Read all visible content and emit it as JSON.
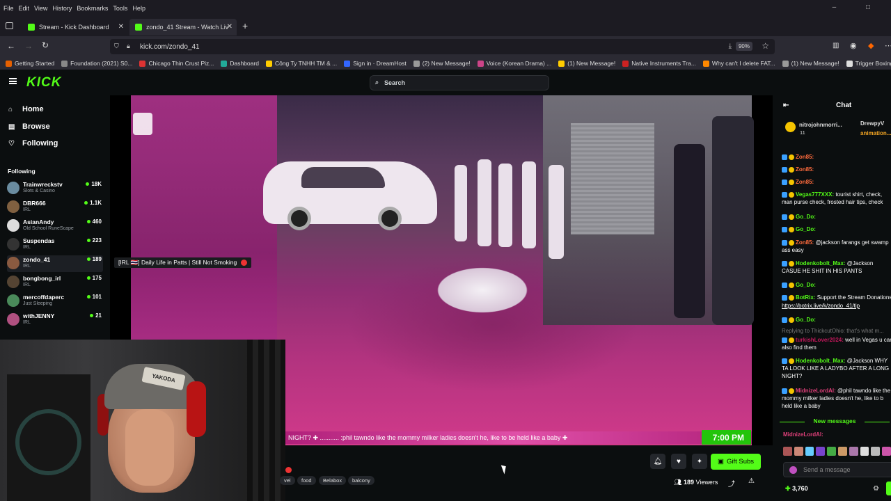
{
  "browser": {
    "menu": [
      "File",
      "Edit",
      "View",
      "History",
      "Bookmarks",
      "Tools",
      "Help"
    ],
    "tabs": [
      {
        "title": "Stream - Kick Dashboard",
        "active": false
      },
      {
        "title": "zondo_41 Stream - Watch Live",
        "active": true
      }
    ],
    "url": "kick.com/zondo_41",
    "zoom": "90%",
    "bookmarks": [
      {
        "label": "Getting Started",
        "color": "#e66000"
      },
      {
        "label": "Foundation (2021) S0...",
        "color": "#888"
      },
      {
        "label": "Chicago Thin Crust Piz...",
        "color": "#d33"
      },
      {
        "label": "Dashboard",
        "color": "#2a9"
      },
      {
        "label": "Công Ty TNHH TM & ...",
        "color": "#fc0"
      },
      {
        "label": "Sign in · DreamHost",
        "color": "#36f"
      },
      {
        "label": "(2) New Message!",
        "color": "#999"
      },
      {
        "label": "Voice (Korean Drama) ...",
        "color": "#c48"
      },
      {
        "label": "(1) New Message!",
        "color": "#fc0"
      },
      {
        "label": "Native Instruments Tra...",
        "color": "#c22"
      },
      {
        "label": "Why can't I delete FAT...",
        "color": "#f80"
      },
      {
        "label": "(1) New Message!",
        "color": "#999"
      },
      {
        "label": "Trigger Boxing",
        "color": "#ddd"
      }
    ]
  },
  "kick": {
    "logo": "KICK",
    "search_placeholder": "Search",
    "accent": "#53fc18",
    "nav": [
      {
        "label": "Home",
        "icon": "home-icon"
      },
      {
        "label": "Browse",
        "icon": "browse-icon"
      },
      {
        "label": "Following",
        "icon": "heart-icon"
      }
    ],
    "following_heading": "Following",
    "following": [
      {
        "name": "Trainwreckstv",
        "category": "Slots & Casino",
        "viewers": "18K",
        "color": "#6a8ca0"
      },
      {
        "name": "DBR666",
        "category": "IRL",
        "viewers": "1.1K",
        "color": "#806040"
      },
      {
        "name": "AsianAndy",
        "category": "Old School RuneScape",
        "viewers": "460",
        "color": "#ddd"
      },
      {
        "name": "Suspendas",
        "category": "IRL",
        "viewers": "223",
        "color": "#333"
      },
      {
        "name": "zondo_41",
        "category": "IRL",
        "viewers": "189",
        "color": "#8a5a40"
      },
      {
        "name": "bongbong_irl",
        "category": "IRL",
        "viewers": "175",
        "color": "#554433"
      },
      {
        "name": "mercoffdaperc",
        "category": "Just Sleeping",
        "viewers": "101",
        "color": "#4a8a5a"
      },
      {
        "name": "withJENNY",
        "category": "IRL",
        "viewers": "21",
        "color": "#b05080"
      }
    ],
    "stream_title_badge": "[IRL 🇹🇭] Daily Life in Patts | Still Not Smoking",
    "ticker_text": "NIGHT? ✚ ........... :phil tawndo like the mommy milker ladies doesn't he, like to be held like a baby ✚",
    "clock": "7:00 PM",
    "webcam_cap_text": "YAKODA",
    "tags": [
      "vel",
      "food",
      "Belabox",
      "balcony"
    ],
    "gift_button": "Gift Subs",
    "viewers_count": "189",
    "viewers_label": "Viewers"
  },
  "chat": {
    "title": "Chat",
    "pinned": {
      "user": "nitrojohnmorri...",
      "count": "11",
      "user2": "DrewpyV",
      "sub2": "animation..."
    },
    "messages": [
      {
        "user": "Zon85:",
        "text": "",
        "color": "#ff6b3d"
      },
      {
        "user": "Zon85:",
        "text": "",
        "color": "#ff6b3d"
      },
      {
        "user": "Zon85:",
        "text": "",
        "color": "#ff6b3d"
      },
      {
        "user": "Vegas777XXX:",
        "text": "tourist shirt, check, man purse check, frosted hair tips, check",
        "color": "#53fc18"
      },
      {
        "user": "Go_Do:",
        "text": "",
        "color": "#53fc18"
      },
      {
        "user": "Go_Do:",
        "text": "",
        "color": "#53fc18"
      },
      {
        "user": "Zon85:",
        "text": "@jackson farangs get swamp ass easy",
        "color": "#ff6b3d"
      },
      {
        "user": "Hodenkobolt_Max:",
        "text": "@Jackson CASUE HE SHIT IN HIS PANTS",
        "color": "#53fc18"
      },
      {
        "user": "Go_Do:",
        "text": "",
        "color": "#53fc18"
      },
      {
        "user": "BotRix:",
        "text": "Support the Stream Donations",
        "color": "#53fc18"
      },
      {
        "user": "",
        "text": "https://botrix.live/k/zondo_41/tip",
        "color": "#ffffff"
      },
      {
        "user": "Go_Do:",
        "text": "",
        "color": "#53fc18"
      },
      {
        "user": "",
        "text": "Replying to ThickcutOhio: that's what m...",
        "color": "#777"
      },
      {
        "user": "turkishLover2024:",
        "text": "well in Vegas u can also find them",
        "color": "#c2185b"
      },
      {
        "user": "Hodenkobolt_Max:",
        "text": "@Jackson WHY TA LOOK LIKE A LADYBO AFTER A LONG NIGHT?",
        "color": "#53fc18"
      },
      {
        "user": "MidnizeLordAl:",
        "text": "@phil tawndo like the mommy milker ladies doesn't he, like to b held like a baby",
        "color": "#e0407a"
      }
    ],
    "new_messages": "New messages",
    "last_user": "MidnizeLordAl:",
    "input_placeholder": "Send a message",
    "points": "3,760"
  }
}
